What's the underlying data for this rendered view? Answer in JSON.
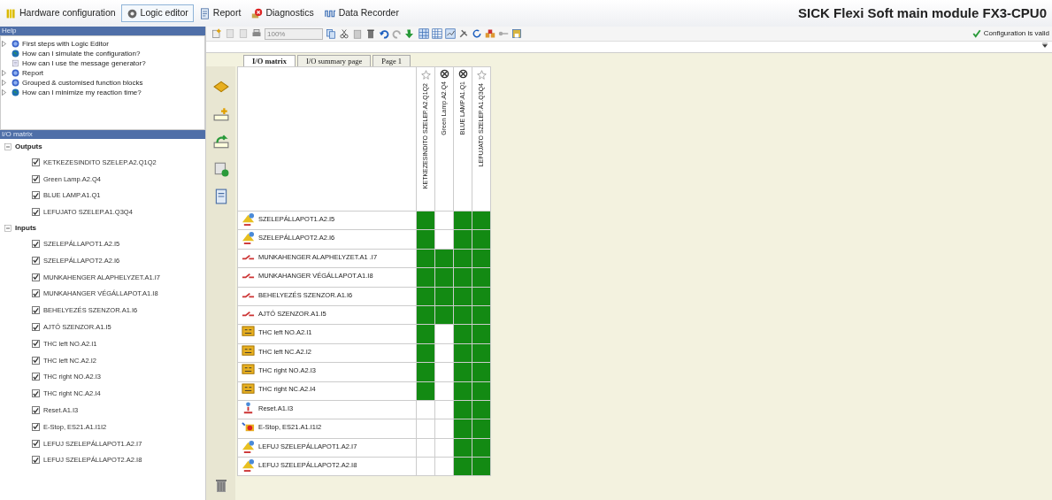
{
  "nav_tabs": [
    {
      "label": "Hardware configuration",
      "selected": false
    },
    {
      "label": "Logic editor",
      "selected": true
    },
    {
      "label": "Report",
      "selected": false
    },
    {
      "label": "Diagnostics",
      "selected": false
    },
    {
      "label": "Data Recorder",
      "selected": false
    }
  ],
  "module_title": "SICK Flexi Soft main module FX3-CPU0",
  "status": "Configuration is valid",
  "zoom": {
    "value": "100%"
  },
  "help_panel": {
    "title": "Help",
    "items": [
      {
        "label": "First steps with Logic Editor",
        "kind": "topic",
        "expandable": true
      },
      {
        "label": "How can I simulate the configuration?",
        "kind": "web",
        "expandable": false
      },
      {
        "label": "How can I use the message generator?",
        "kind": "page",
        "expandable": false
      },
      {
        "label": "Report",
        "kind": "topic",
        "expandable": true
      },
      {
        "label": "Grouped & customised function blocks",
        "kind": "topic",
        "expandable": true
      },
      {
        "label": "How can I minimize my reaction time?",
        "kind": "web",
        "expandable": true
      }
    ]
  },
  "io_panel": {
    "title": "I/O matrix",
    "groups": [
      {
        "label": "Outputs",
        "expanded": true,
        "children": [
          {
            "label": "KETKEZESINDITO SZELEP.A2.Q1Q2",
            "checked": true
          },
          {
            "label": "Green Lamp.A2.Q4",
            "checked": true
          },
          {
            "label": "BLUE LAMP.A1.Q1",
            "checked": true
          },
          {
            "label": "LEFUJATO SZELEP.A1.Q3Q4",
            "checked": true
          }
        ]
      },
      {
        "label": "Inputs",
        "expanded": true,
        "children": [
          {
            "label": "SZELEPÁLLAPOT1.A2.I5",
            "checked": true
          },
          {
            "label": "SZELEPÁLLAPOT2.A2.I6",
            "checked": true
          },
          {
            "label": "MUNKAHENGER ALAPHELYZET.A1.I7",
            "checked": true
          },
          {
            "label": "MUNKAHANGER VÉGÁLLAPOT.A1.I8",
            "checked": true
          },
          {
            "label": "BEHELYEZÉS SZENZOR.A1.I6",
            "checked": true
          },
          {
            "label": "AJTÓ SZENZOR.A1.I5",
            "checked": true
          },
          {
            "label": "THC left NO.A2.I1",
            "checked": true
          },
          {
            "label": "THC left NC.A2.I2",
            "checked": true
          },
          {
            "label": "THC right NO.A2.I3",
            "checked": true
          },
          {
            "label": "THC right NC.A2.I4",
            "checked": true
          },
          {
            "label": "Reset.A1.I3",
            "checked": true
          },
          {
            "label": "E-Stop, ES21.A1.I1I2",
            "checked": true
          },
          {
            "label": "LEFUJ SZELEPÁLLAPOT1.A2.I7",
            "checked": true
          },
          {
            "label": "LEFUJ SZELEPÁLLAPOT2.A2.I8",
            "checked": true
          }
        ]
      }
    ]
  },
  "page_tabs": [
    {
      "label": "I/O matrix",
      "selected": true
    },
    {
      "label": "I/O summary page",
      "selected": false
    },
    {
      "label": "Page 1",
      "selected": false
    }
  ],
  "matrix": {
    "columns": [
      {
        "label": "KETKEZESINDITO SZELEP.A2.Q1Q2",
        "kind": "valve"
      },
      {
        "label": "Green Lamp.A2.Q4",
        "kind": "lamp"
      },
      {
        "label": "BLUE LAMP.A1.Q1",
        "kind": "lamp"
      },
      {
        "label": "LEFUJATO SZELEP.A1.Q3Q4",
        "kind": "valve"
      }
    ],
    "rows": [
      {
        "label": "SZELEPÁLLAPOT1.A2.I5",
        "kind": "sensor",
        "cells": [
          true,
          false,
          true,
          true
        ]
      },
      {
        "label": "SZELEPÁLLAPOT2.A2.I6",
        "kind": "sensor",
        "cells": [
          true,
          false,
          true,
          true
        ]
      },
      {
        "label": "MUNKAHENGER  ALAPHELYZET.A1 .I7",
        "kind": "switch",
        "cells": [
          true,
          true,
          true,
          true
        ]
      },
      {
        "label": "MUNKAHANGER  VÉGÁLLAPOT.A1.I8",
        "kind": "switch",
        "cells": [
          true,
          true,
          true,
          true
        ]
      },
      {
        "label": "BEHELYEZÉS  SZENZOR.A1.I6",
        "kind": "switch",
        "cells": [
          true,
          true,
          true,
          true
        ]
      },
      {
        "label": "AJTÓ SZENZOR.A1.I5",
        "kind": "switch",
        "cells": [
          true,
          true,
          true,
          true
        ]
      },
      {
        "label": "THC left NO.A2.I1",
        "kind": "block",
        "cells": [
          true,
          false,
          true,
          true
        ]
      },
      {
        "label": "THC left NC.A2.I2",
        "kind": "block",
        "cells": [
          true,
          false,
          true,
          true
        ]
      },
      {
        "label": "THC right NO.A2.I3",
        "kind": "block",
        "cells": [
          true,
          false,
          true,
          true
        ]
      },
      {
        "label": "THC right NC.A2.I4",
        "kind": "block",
        "cells": [
          true,
          false,
          true,
          true
        ]
      },
      {
        "label": "Reset.A1.I3",
        "kind": "reset",
        "cells": [
          false,
          false,
          true,
          true
        ]
      },
      {
        "label": "E-Stop, ES21.A1.I1I2",
        "kind": "estop",
        "cells": [
          false,
          false,
          true,
          true
        ]
      },
      {
        "label": "LEFUJ  SZELEPÁLLAPOT1.A2.I7",
        "kind": "sensor",
        "cells": [
          false,
          false,
          true,
          true
        ]
      },
      {
        "label": "LEFUJ  SZELEPÁLLAPOT2.A2.I8",
        "kind": "sensor",
        "cells": [
          false,
          false,
          true,
          true
        ]
      }
    ]
  }
}
